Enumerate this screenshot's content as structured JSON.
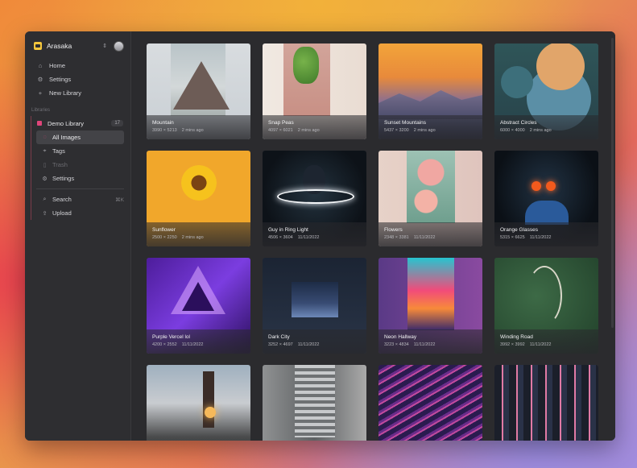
{
  "app": {
    "name": "Arasaka"
  },
  "sidebar": {
    "nav": [
      {
        "label": "Home",
        "icon": "home-icon"
      },
      {
        "label": "Settings",
        "icon": "gear-icon"
      },
      {
        "label": "New Library",
        "icon": "plus-icon"
      }
    ],
    "section_label": "Libraries",
    "library": {
      "name": "Demo Library",
      "count": "17",
      "color": "#e0457a",
      "items": [
        {
          "label": "All Images",
          "icon": "image-icon",
          "active": true
        },
        {
          "label": "Tags",
          "icon": "tag-icon"
        },
        {
          "label": "Trash",
          "icon": "trash-icon",
          "disabled": true
        },
        {
          "label": "Settings",
          "icon": "gear-icon"
        }
      ],
      "tools": [
        {
          "label": "Search",
          "icon": "search-icon",
          "shortcut": "⌘K"
        },
        {
          "label": "Upload",
          "icon": "upload-icon"
        }
      ]
    }
  },
  "images": [
    {
      "title": "Mountain",
      "dims": "3990 × 5213",
      "date": "2 mins ago"
    },
    {
      "title": "Snap Peas",
      "dims": "4097 × 6021",
      "date": "2 mins ago"
    },
    {
      "title": "Sunset Mountains",
      "dims": "5437 × 3200",
      "date": "2 mins ago"
    },
    {
      "title": "Abstract Circles",
      "dims": "6000 × 4000",
      "date": "2 mins ago"
    },
    {
      "title": "Sunflower",
      "dims": "2500 × 2250",
      "date": "2 mins ago"
    },
    {
      "title": "Guy in Ring Light",
      "dims": "4506 × 3604",
      "date": "11/11/2022"
    },
    {
      "title": "Flowers",
      "dims": "2348 × 3381",
      "date": "11/11/2022"
    },
    {
      "title": "Orange Glasses",
      "dims": "5315 × 6625",
      "date": "11/11/2022"
    },
    {
      "title": "Purple Vercel lol",
      "dims": "4200 × 2552",
      "date": "11/11/2022"
    },
    {
      "title": "Dark City",
      "dims": "3252 × 4697",
      "date": "11/11/2022"
    },
    {
      "title": "Neon Hallway",
      "dims": "3223 × 4834",
      "date": "11/11/2022"
    },
    {
      "title": "Winding Road",
      "dims": "3992 × 3992",
      "date": "11/11/2022"
    }
  ]
}
